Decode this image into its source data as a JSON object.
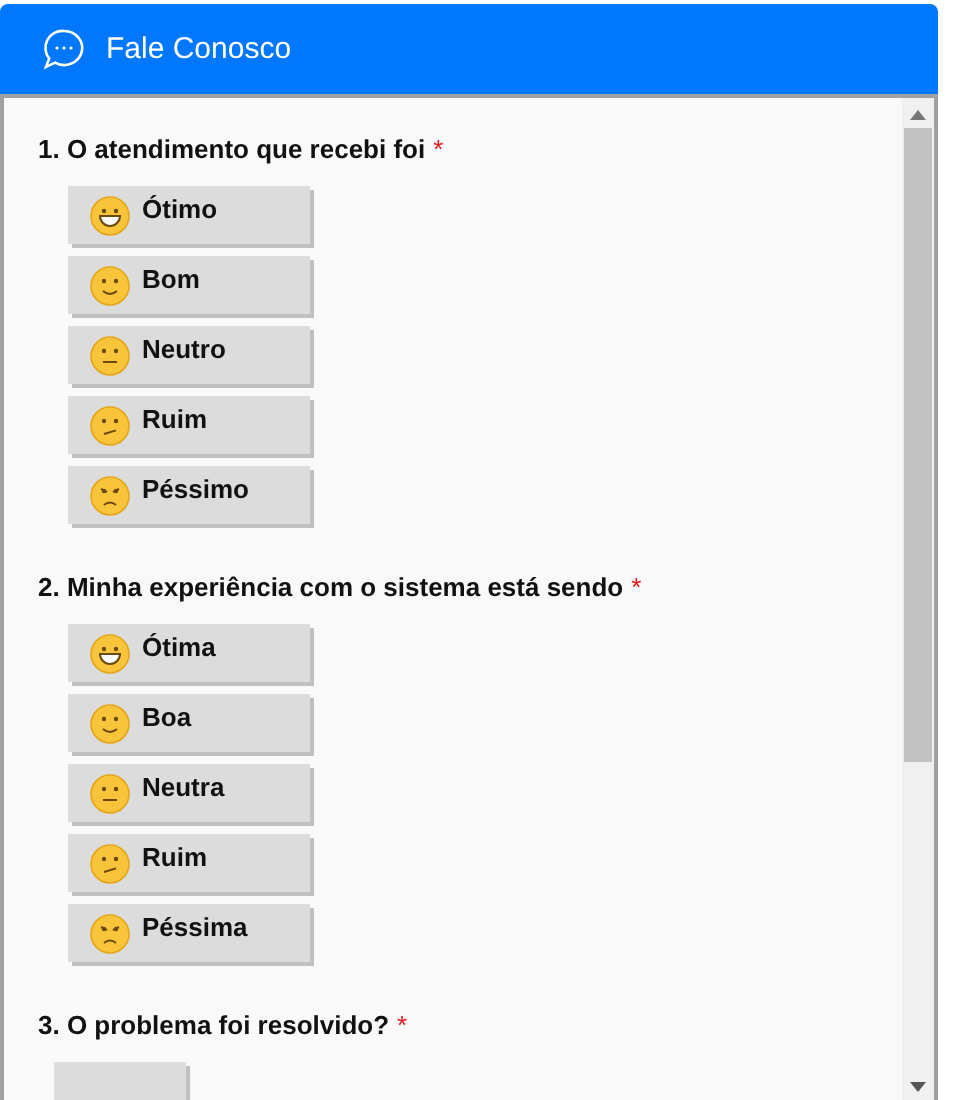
{
  "header": {
    "title": "Fale Conosco"
  },
  "questions": [
    {
      "label": "1. O atendimento que recebi foi",
      "required_mark": "*",
      "options": [
        {
          "label": "Ótimo",
          "kind": "grin"
        },
        {
          "label": "Bom",
          "kind": "smile"
        },
        {
          "label": "Neutro",
          "kind": "neutral"
        },
        {
          "label": "Ruim",
          "kind": "confused"
        },
        {
          "label": "Péssimo",
          "kind": "angry"
        }
      ]
    },
    {
      "label": "2. Minha experiência com o sistema está sendo",
      "required_mark": "*",
      "options": [
        {
          "label": "Ótima",
          "kind": "grin"
        },
        {
          "label": "Boa",
          "kind": "smile"
        },
        {
          "label": "Neutra",
          "kind": "neutral"
        },
        {
          "label": "Ruim",
          "kind": "confused"
        },
        {
          "label": "Péssima",
          "kind": "angry"
        }
      ]
    },
    {
      "label": "3. O problema foi resolvido?",
      "required_mark": "*",
      "partial_option": true
    }
  ]
}
